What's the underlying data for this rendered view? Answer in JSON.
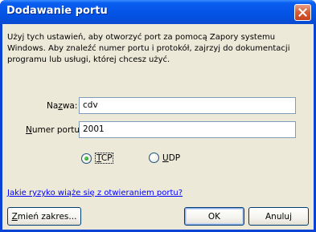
{
  "window": {
    "title": "Dodawanie portu"
  },
  "description": "Użyj tych ustawień, aby otworzyć port za pomocą Zapory systemu Windows. Aby znaleźć numer portu i protokół, zajrzyj do dokumentacji programu lub usługi, której chcesz użyć.",
  "form": {
    "name_label_pre": "Na",
    "name_label_u": "z",
    "name_label_post": "wa:",
    "name_value": "cdv",
    "port_label_pre": "",
    "port_label_u": "N",
    "port_label_post": "umer portu:",
    "port_value": "2001"
  },
  "protocol": {
    "tcp_u": "T",
    "tcp_rest": "CP",
    "udp_u": "U",
    "udp_rest": "DP",
    "selected": "TCP"
  },
  "link_text": "Jakie ryzyko wiąże się z otwieraniem portu?",
  "buttons": {
    "change_scope_u": "Z",
    "change_scope_rest": "mień zakres...",
    "ok": "OK",
    "cancel": "Anuluj"
  },
  "icons": {
    "close": "close-icon"
  }
}
